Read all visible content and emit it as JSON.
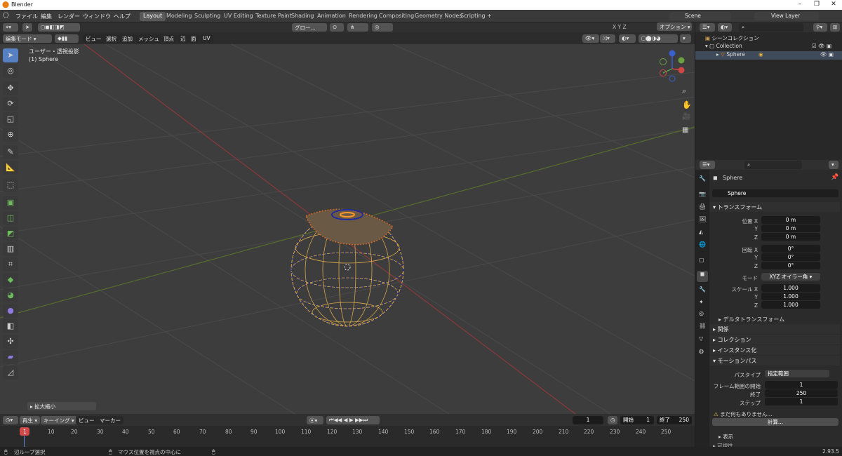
{
  "app": {
    "title": "Blender",
    "version": "2.93.5"
  },
  "menus": [
    "ファイル",
    "編集",
    "レンダー",
    "ウィンドウ",
    "ヘルプ"
  ],
  "workspaces": [
    "Layout",
    "Modeling",
    "Sculpting",
    "UV Editing",
    "Texture Paint",
    "Shading",
    "Animation",
    "Rendering",
    "Compositing",
    "Geometry Nodes",
    "Scripting"
  ],
  "active_workspace": "Layout",
  "scene": {
    "name": "Scene",
    "view_layer": "View Layer"
  },
  "viewport_header": {
    "mode": "編集モード",
    "menus": [
      "ビュー",
      "選択",
      "追加",
      "メッシュ",
      "頂点",
      "辺",
      "面",
      "UV"
    ],
    "transform_orientation": "グロー...",
    "options": "オプション",
    "axes": [
      "X",
      "Y",
      "Z"
    ]
  },
  "viewport": {
    "view_name": "ユーザー・透視投影",
    "object_label": "(1) Sphere",
    "last_op": "拡大縮小"
  },
  "outliner": {
    "root": "シーンコレクション",
    "collection": "Collection",
    "object": "Sphere"
  },
  "properties": {
    "object_name": "Sphere",
    "object_field": "Sphere",
    "transform_title": "トランスフォーム",
    "location": {
      "label": "位置 X",
      "x": "0 m",
      "y": "0 m",
      "z": "0 m"
    },
    "rotation": {
      "label": "回転 X",
      "x": "0°",
      "y": "0°",
      "z": "0°"
    },
    "mode_label": "モード",
    "mode_value": "XYZ オイラー角",
    "scale": {
      "label": "スケール X",
      "x": "1.000",
      "y": "1.000",
      "z": "1.000"
    },
    "axis_y": "Y",
    "axis_z": "Z",
    "delta": "デルタトランスフォーム",
    "sections": [
      "関係",
      "コレクション",
      "インスタンス化"
    ],
    "motion": {
      "title": "モーションパス",
      "path_type_label": "パスタイプ",
      "path_type": "指定範囲",
      "frame_start_label": "フレーム範囲の開始",
      "frame_start": "1",
      "end_label": "終了",
      "end": "250",
      "step_label": "ステップ",
      "step": "1",
      "warning": "まだ何もありません...",
      "calc": "計算..."
    },
    "display": "表示",
    "visibility": "可視性"
  },
  "timeline": {
    "play_label": "再生",
    "keying_label": "キーイング",
    "view_label": "ビュー",
    "marker_label": "マーカー",
    "current_frame": "1",
    "start_label": "開始",
    "start": "1",
    "end_label": "終了",
    "end": "250",
    "ruler": [
      "1",
      "10",
      "20",
      "30",
      "40",
      "50",
      "60",
      "70",
      "80",
      "90",
      "100",
      "110",
      "120",
      "130",
      "140",
      "150",
      "160",
      "170",
      "180",
      "190",
      "200",
      "210",
      "220",
      "230",
      "240",
      "250"
    ]
  },
  "status": {
    "left": "辺ループ選択",
    "middle": "マウス位置を視点の中心に"
  }
}
